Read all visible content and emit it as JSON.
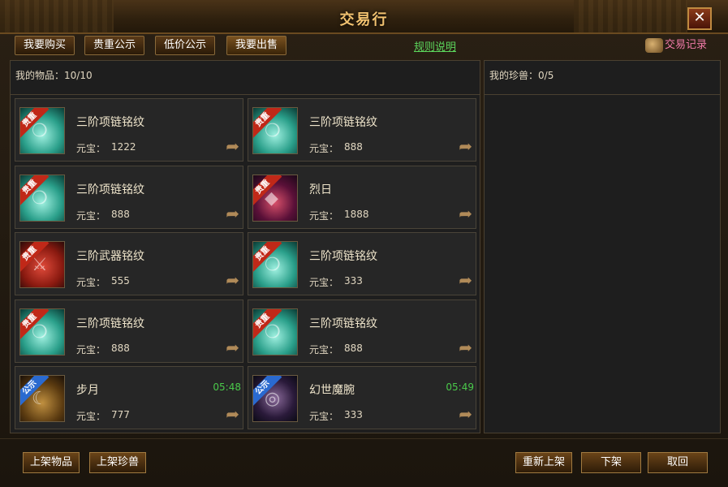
{
  "window": {
    "title": "交易行",
    "close_icon": "✕"
  },
  "tabs": [
    "我要购买",
    "贵重公示",
    "低价公示",
    "我要出售"
  ],
  "rules_link": "规则说明",
  "trade_record": "交易记录",
  "my_items": {
    "label": "我的物品：",
    "count": "10/10"
  },
  "my_pets": {
    "label": "我的珍兽：",
    "count": "0/5"
  },
  "price_label": "元宝：",
  "items": [
    {
      "name": "三阶项链铭纹",
      "price": "1222",
      "badge": "贵重",
      "badge_color": "#c02818",
      "icon": "necklace-icon",
      "timer": ""
    },
    {
      "name": "三阶项链铭纹",
      "price": "888",
      "badge": "贵重",
      "badge_color": "#c02818",
      "icon": "necklace-icon",
      "timer": ""
    },
    {
      "name": "三阶项链铭纹",
      "price": "888",
      "badge": "贵重",
      "badge_color": "#c02818",
      "icon": "necklace-icon",
      "timer": ""
    },
    {
      "name": "烈日",
      "price": "1888",
      "badge": "贵重",
      "badge_color": "#c02818",
      "icon": "sun-pendant-icon",
      "timer": ""
    },
    {
      "name": "三阶武器铭纹",
      "price": "555",
      "badge": "贵重",
      "badge_color": "#c02818",
      "icon": "weapon-icon",
      "timer": ""
    },
    {
      "name": "三阶项链铭纹",
      "price": "333",
      "badge": "贵重",
      "badge_color": "#c02818",
      "icon": "necklace-icon",
      "timer": ""
    },
    {
      "name": "三阶项链铭纹",
      "price": "888",
      "badge": "贵重",
      "badge_color": "#c02818",
      "icon": "necklace-icon",
      "timer": ""
    },
    {
      "name": "三阶项链铭纹",
      "price": "888",
      "badge": "贵重",
      "badge_color": "#c02818",
      "icon": "necklace-icon",
      "timer": ""
    },
    {
      "name": "步月",
      "price": "777",
      "badge": "公示",
      "badge_color": "#2a6ad0",
      "icon": "moon-step-icon",
      "timer": "05:48"
    },
    {
      "name": "幻世魔腕",
      "price": "333",
      "badge": "公示",
      "badge_color": "#2a6ad0",
      "icon": "bracer-icon",
      "timer": "05:49"
    }
  ],
  "buttons": {
    "list_item": "上架物品",
    "list_pet": "上架珍兽",
    "relist": "重新上架",
    "delist": "下架",
    "cancel": "取回"
  }
}
